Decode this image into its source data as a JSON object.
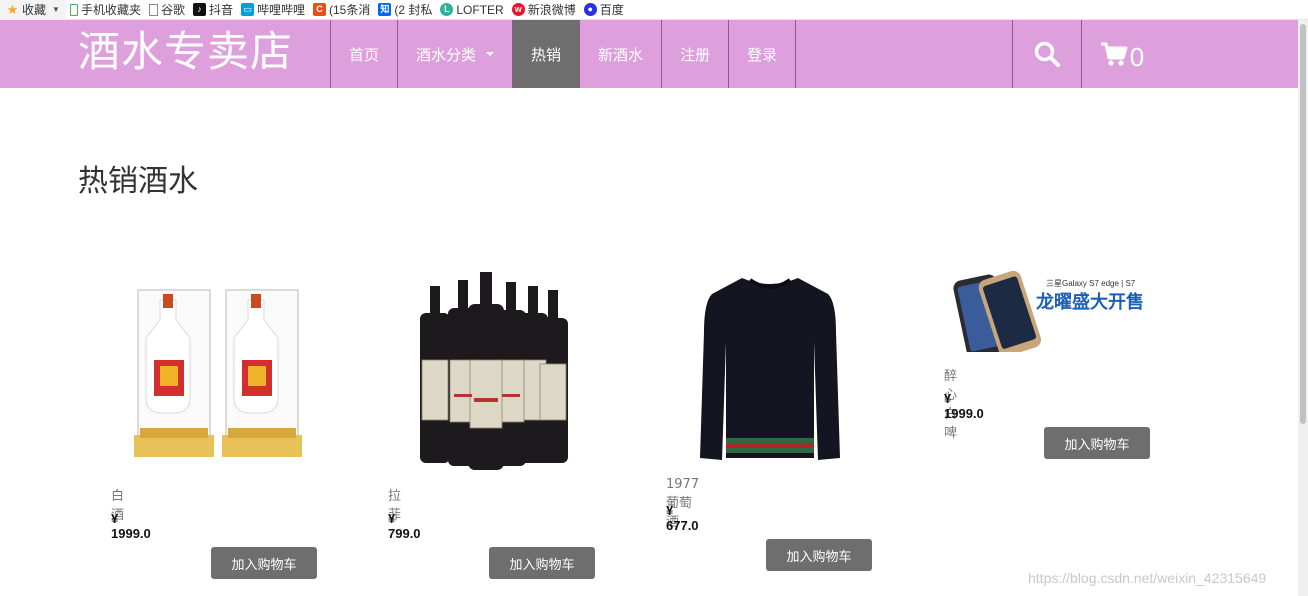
{
  "bookmarks": [
    {
      "label": "收藏",
      "icon": "star-icon",
      "color": "#f5a623"
    },
    {
      "label": "手机收藏夹",
      "icon": "phone-icon",
      "color": "#4caf50"
    },
    {
      "label": "谷歌",
      "icon": "page-icon",
      "color": "#9e9e9e"
    },
    {
      "label": "抖音",
      "icon": "douyin-icon",
      "color": "#111111"
    },
    {
      "label": "哔哩哔哩",
      "icon": "bilibili-icon",
      "color": "#00a1d6"
    },
    {
      "label": "(15条消",
      "icon": "csdn-icon",
      "color": "#e94e1b"
    },
    {
      "label": "(2 封私",
      "icon": "zhihu-icon",
      "color": "#0066ff"
    },
    {
      "label": "LOFTER",
      "icon": "lofter-icon",
      "color": "#2db19b"
    },
    {
      "label": "新浪微博",
      "icon": "weibo-icon",
      "color": "#e6162d"
    },
    {
      "label": "百度",
      "icon": "baidu-icon",
      "color": "#2932e1"
    }
  ],
  "navbar": {
    "brand": "酒水专卖店",
    "items": [
      "首页",
      "酒水分类",
      "热销",
      "新酒水",
      "注册",
      "登录"
    ],
    "cart_count": "0",
    "bg_color": "#dda0dd",
    "active_color": "#6e6e6e"
  },
  "main": {
    "title": "热销酒水",
    "products": [
      {
        "name": "白酒",
        "price": "¥ 1999.0",
        "button": "加入购物车",
        "image": "baijiu-bottles"
      },
      {
        "name": "拉菲",
        "price": "¥ 799.0",
        "button": "加入购物车",
        "image": "wine-bottles"
      },
      {
        "name": "1977葡萄酒",
        "price": "¥ 677.0",
        "button": "加入购物车",
        "image": "black-sweater"
      },
      {
        "name": "醉心白啤",
        "price": "¥ 1999.0",
        "button": "加入购物车",
        "image": "galaxy-s7-banner"
      }
    ],
    "banner_text_small": "三星Galaxy S7 edge | S7",
    "banner_text_big": "龙曜盛大开售"
  },
  "watermark": "https://blog.csdn.net/weixin_42315649"
}
